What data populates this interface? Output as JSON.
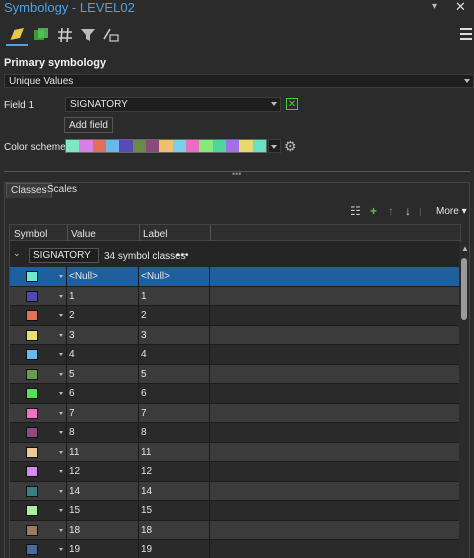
{
  "window": {
    "title": "Symbology - LEVEL02"
  },
  "toolbar": {
    "icons": [
      "primary-symbology-icon",
      "vary-symbology-icon",
      "label-classes-icon",
      "filter-icon",
      "advanced-symbology-icon"
    ]
  },
  "primary": {
    "heading": "Primary symbology",
    "method": "Unique Values",
    "field1_label": "Field 1",
    "field1_value": "SIGNATORY",
    "add_field_label": "Add field",
    "color_scheme_label": "Color scheme",
    "color_scheme": [
      "#7ee8c6",
      "#d880e8",
      "#e0705a",
      "#6ab8e8",
      "#5a4ab8",
      "#6a8a4a",
      "#8a4a7a",
      "#f0c070",
      "#7ad0e8",
      "#e870c0",
      "#8ae878",
      "#4ad8a0",
      "#a070e8",
      "#e8d870",
      "#6ae0c8"
    ]
  },
  "tabs": {
    "classes": "Classes",
    "scales": "Scales"
  },
  "actions": {
    "more_label": "More"
  },
  "table": {
    "col_symbol": "Symbol",
    "col_value": "Value",
    "col_label": "Label",
    "group_field": "SIGNATORY",
    "group_count": "34 symbol classes",
    "group_menu": "•••",
    "rows": [
      {
        "color": "#6ee8d0",
        "value": "<Null>",
        "label": "<Null>"
      },
      {
        "color": "#5248b4",
        "value": "1",
        "label": "1"
      },
      {
        "color": "#e07058",
        "value": "2",
        "label": "2"
      },
      {
        "color": "#e8e070",
        "value": "3",
        "label": "3"
      },
      {
        "color": "#6ab8f0",
        "value": "4",
        "label": "4"
      },
      {
        "color": "#6a9a50",
        "value": "5",
        "label": "5"
      },
      {
        "color": "#58e058",
        "value": "6",
        "label": "6"
      },
      {
        "color": "#f070c8",
        "value": "7",
        "label": "7"
      },
      {
        "color": "#8a4a80",
        "value": "8",
        "label": "8"
      },
      {
        "color": "#f0c898",
        "value": "11",
        "label": "11"
      },
      {
        "color": "#d888f0",
        "value": "12",
        "label": "12"
      },
      {
        "color": "#3a8080",
        "value": "14",
        "label": "14"
      },
      {
        "color": "#a8f0a0",
        "value": "15",
        "label": "15"
      },
      {
        "color": "#a07860",
        "value": "18",
        "label": "18"
      },
      {
        "color": "#4a6aa0",
        "value": "19",
        "label": "19"
      }
    ]
  }
}
